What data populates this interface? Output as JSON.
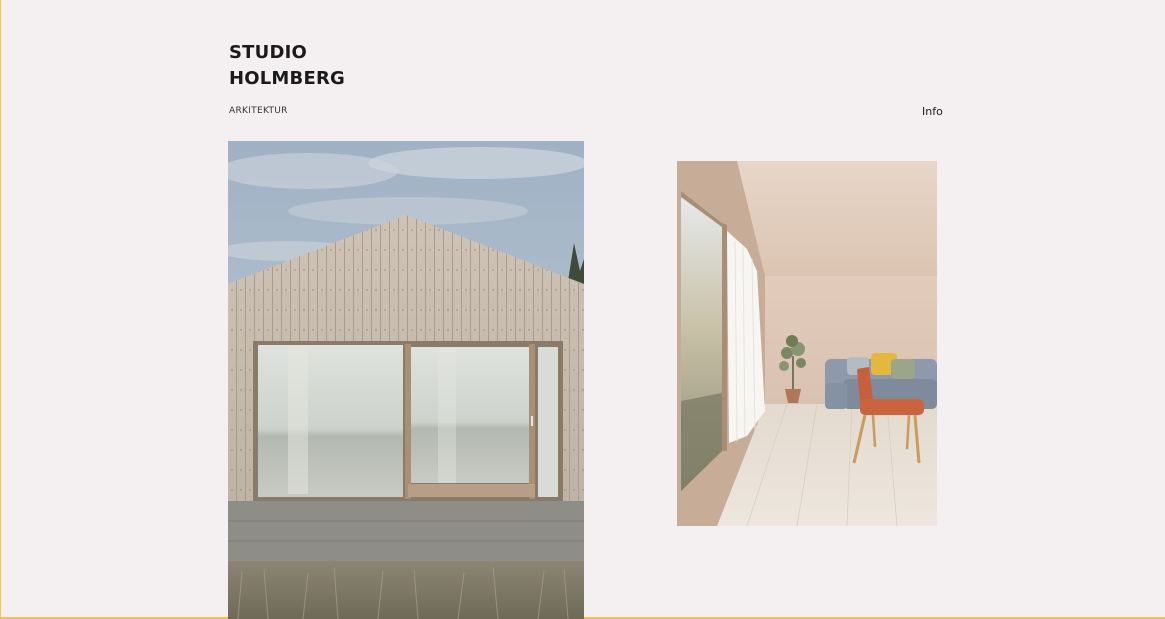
{
  "brand": {
    "line1": "STUDIO",
    "line2": "HOLMBERG"
  },
  "tagline": "ARKITEKTUR",
  "nav": {
    "info_label": "Info"
  },
  "projects": [
    {
      "name": "project-exterior"
    },
    {
      "name": "project-interior"
    }
  ],
  "colors": {
    "background": "#f4f0f1",
    "text": "#1a1a1a",
    "frame_edge": "#f2c64a"
  }
}
